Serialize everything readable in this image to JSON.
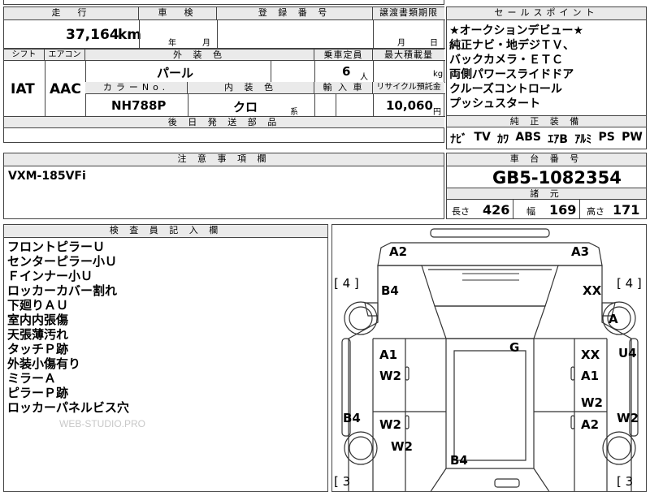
{
  "top": {
    "mileage_header": "走　行",
    "mileage_value": "37,164",
    "mileage_unit": "km",
    "shaken_header": "車　検",
    "shaken_year": "年",
    "shaken_month": "月",
    "reg_header": "登 録 番 号",
    "transfer_header": "譲渡書類期限",
    "transfer_month": "月",
    "transfer_day": "日"
  },
  "row2": {
    "shift_header": "シフト",
    "aircon_header": "エアコン",
    "exterior_header": "外 装 色",
    "capacity_header": "乗車定員",
    "maxload_header": "最大積載量",
    "shift_value": "IAT",
    "aircon_value": "AAC",
    "exterior_value": "パール",
    "capacity_value": "6",
    "capacity_unit": "人",
    "maxload_unit": "kg",
    "colorno_header": "カラーNo.",
    "interior_header": "内 装 色",
    "import_header": "輸 入 車",
    "recycle_header": "リサイクル預託金",
    "colorno_value": "NH788P",
    "interior_value": "クロ",
    "interior_suffix": "系",
    "recycle_value": "10,060",
    "recycle_unit": "円",
    "parts_header": "後 日 発 送 部 品"
  },
  "sales": {
    "header": "セールスポイント",
    "lines": [
      "★オークションデビュー★",
      "純正ナビ・地デジＴＶ、",
      "バックカメラ・ＥＴＣ",
      "両側パワースライドドア",
      "クルーズコントロール",
      "プッシュスタート"
    ],
    "equipment_header": "純 正 装 備",
    "equipment": [
      "ﾅﾋﾞ",
      "TV",
      "ｶﾜ",
      "ABS",
      "ｴｱB",
      "ｱﾙﾐ",
      "PS",
      "PW"
    ]
  },
  "notes": {
    "header": "注 意 事 項 欄",
    "text": "VXM-185VFi"
  },
  "chassis": {
    "header": "車 台 番 号",
    "number": "GB5-1082354",
    "dims_header": "諸 元",
    "length_label": "長さ",
    "length_value": "426",
    "width_label": "幅",
    "width_value": "169",
    "height_label": "高さ",
    "height_value": "171"
  },
  "inspector": {
    "header": "検 査 員 記 入 欄",
    "lines": [
      "フロントピラーＵ",
      "センターピラー小Ｕ",
      "Ｆインナー小Ｕ",
      "ロッカーカバー割れ",
      "下廻りＡＵ",
      "室内内張傷",
      "天張薄汚れ",
      "タッチＰ跡",
      "外装小傷有り",
      "ミラーＡ",
      "ピラーＰ跡",
      "ロッカーパネルビス穴"
    ],
    "watermark": "WEB-STUDIO.PRO"
  },
  "diagram": {
    "labels": {
      "a2": "A2",
      "a3": "A3",
      "tire_fl": "[ 4 ]",
      "tire_fr": "[ 4 ]",
      "b4_top": "B4",
      "xx_top": "XX",
      "a_wheel": "A",
      "g": "G",
      "a1_left": "A1",
      "xx_right": "XX",
      "u4": "U4",
      "w2_left": "W2",
      "a1_right": "A1",
      "w2_right": "W2",
      "b4_left": "B4",
      "w2_left2": "W2",
      "a2_right": "A2",
      "w2_far": "W2",
      "w2_rear": "W2",
      "b4_rear": "B4",
      "tire_rl": "[ 3",
      "tire_rr": "[ 3"
    }
  }
}
